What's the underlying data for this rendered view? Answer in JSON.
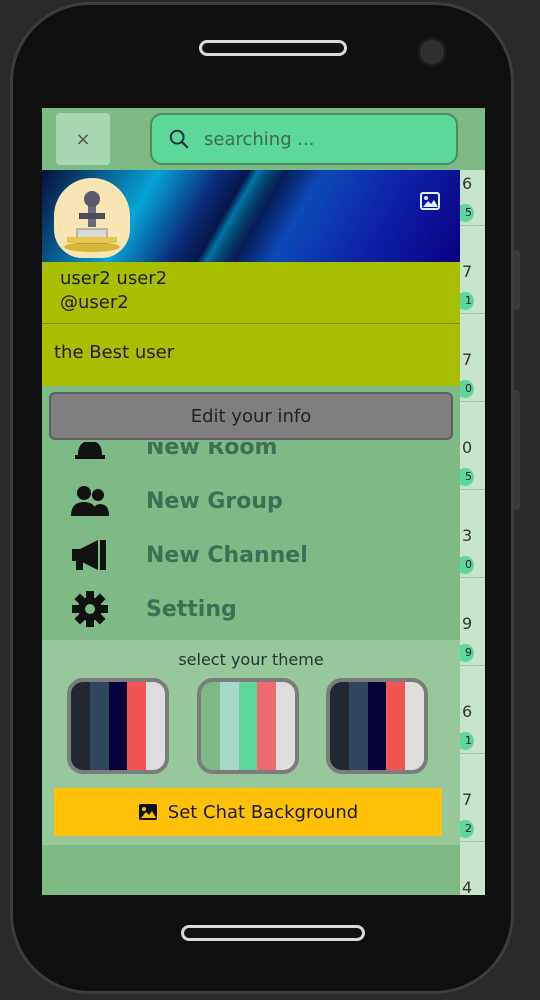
{
  "top_bar": {
    "close_label": "×",
    "search_placeholder": "searching ..."
  },
  "profile": {
    "name": "user2 user2",
    "handle": "@user2",
    "bio": "the Best user"
  },
  "edit_button_label": "Edit your info",
  "menu": [
    {
      "label": "New Room",
      "icon": "bell-icon"
    },
    {
      "label": "New Group",
      "icon": "group-icon"
    },
    {
      "label": "New Channel",
      "icon": "megaphone-icon"
    },
    {
      "label": "Setting",
      "icon": "gear-icon"
    }
  ],
  "theme": {
    "title": "select your theme",
    "palettes": [
      [
        "#222831",
        "#30475e",
        "#06003a",
        "#f05454",
        "#dddddd"
      ],
      [
        "#7dba86",
        "#a8d8c9",
        "#5ed79b",
        "#f06c6c",
        "#dddddd"
      ],
      [
        "#222831",
        "#30475e",
        "#06003a",
        "#f05454",
        "#dddddd"
      ]
    ]
  },
  "set_background_label": "Set Chat Background",
  "background_list": {
    "numbers": [
      "6",
      "7",
      "7",
      "0",
      "3",
      "9",
      "6",
      "7",
      "4"
    ],
    "badges": [
      "5",
      "1",
      "0",
      "5",
      "0",
      "9",
      "1",
      "2"
    ]
  },
  "colors": {
    "screen_bg": "#7dba86",
    "search_bg": "#5ed79b",
    "user_panel": "#a8bf00",
    "edit_button": "#7f7f7f",
    "set_background_button": "#ffc107"
  }
}
